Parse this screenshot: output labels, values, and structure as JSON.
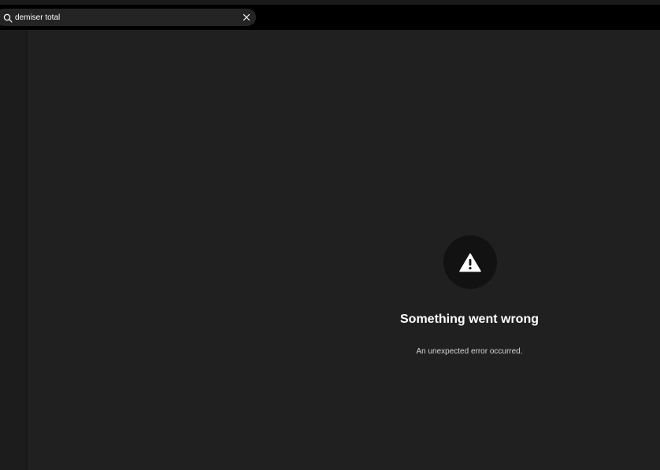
{
  "search": {
    "value": "demiser total",
    "search_icon": "search-icon",
    "clear_icon": "close-icon"
  },
  "error": {
    "icon": "warning-icon",
    "title": "Something went wrong",
    "message": "An unexpected error occurred."
  },
  "colors": {
    "background": "#121212",
    "topbar": "#000000",
    "search_field": "#242424",
    "main_panel": "#202020",
    "sidebar": "#1c1c1c",
    "text_primary": "#ffffff",
    "text_secondary": "#d6d6d6"
  }
}
